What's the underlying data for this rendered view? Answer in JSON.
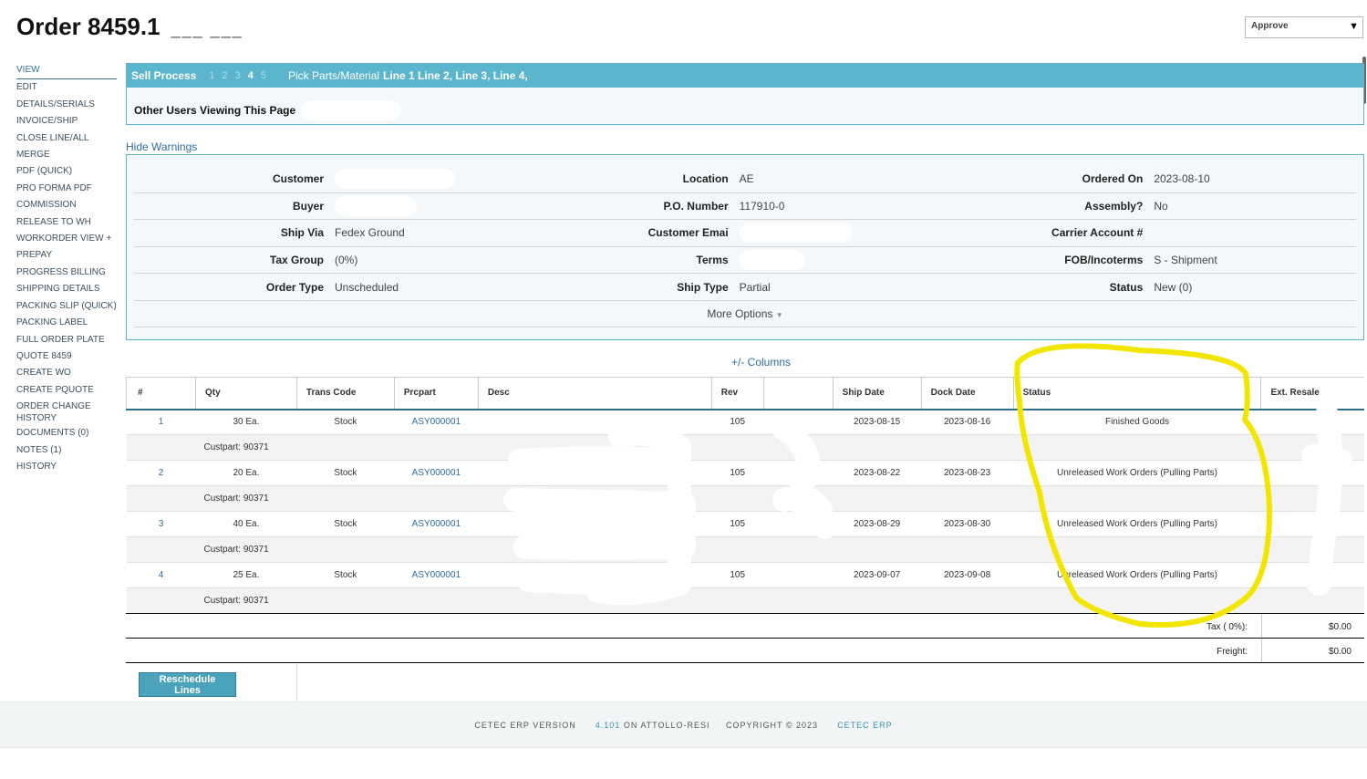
{
  "header": {
    "title": "Order 8459.1",
    "title_suffix": "___ ___",
    "approve_label": "Approve"
  },
  "nav": [
    "VIEW",
    "EDIT",
    "DETAILS/SERIALS",
    "INVOICE/SHIP",
    "CLOSE LINE/ALL",
    "MERGE",
    "PDF (QUICK)",
    "PRO FORMA PDF",
    "COMMISSION",
    "RELEASE TO WH",
    "WORKORDER VIEW +",
    "PREPAY",
    "PROGRESS BILLING",
    "SHIPPING DETAILS",
    "PACKING SLIP (QUICK)",
    "PACKING LABEL",
    "FULL ORDER PLATE",
    "QUOTE 8459",
    "CREATE WO",
    "CREATE PQUOTE",
    "ORDER CHANGE HISTORY",
    "DOCUMENTS (0)",
    "NOTES (1)",
    "HISTORY"
  ],
  "process": {
    "title": "Sell Process",
    "steps": [
      "1",
      "2",
      "3",
      "4",
      "5"
    ],
    "current_step": "4",
    "pick_label": "Pick Parts/Material",
    "lines": "Line 1 Line 2, Line 3, Line 4,",
    "viewers_label": "Other Users Viewing This Page"
  },
  "warnings_toggle": "Hide Warnings",
  "details": {
    "rows": [
      [
        [
          "Customer",
          ""
        ],
        [
          "Location",
          "AE"
        ],
        [
          "Ordered On",
          "2023-08-10"
        ]
      ],
      [
        [
          "Buyer",
          ""
        ],
        [
          "P.O. Number",
          "117910-0"
        ],
        [
          "Assembly?",
          "No"
        ]
      ],
      [
        [
          "Ship Via",
          "Fedex Ground"
        ],
        [
          "Customer Emai",
          ""
        ],
        [
          "Carrier Account #",
          ""
        ]
      ],
      [
        [
          "Tax Group",
          "(0%)"
        ],
        [
          "Terms",
          ""
        ],
        [
          "FOB/Incoterms",
          "S - Shipment"
        ]
      ],
      [
        [
          "Order Type",
          "Unscheduled"
        ],
        [
          "Ship Type",
          "Partial"
        ],
        [
          "Status",
          "New (0)"
        ]
      ]
    ],
    "more_options": "More Options"
  },
  "columns_toggle": "+/- Columns",
  "table": {
    "headers": [
      "#",
      "Qty",
      "Trans Code",
      "Prcpart",
      "Desc",
      "Rev",
      "",
      "Ship Date",
      "Dock Date",
      "Status",
      "Ext. Resale"
    ],
    "rows": [
      {
        "num": "1",
        "qty": "30 Ea.",
        "trans": "Stock",
        "part": "ASY000001",
        "desc": "",
        "rev": "105",
        "ship": "2023-08-15",
        "dock": "2023-08-16",
        "status": "Finished Goods",
        "resale": "",
        "custpart": "Custpart: 90371"
      },
      {
        "num": "2",
        "qty": "20 Ea.",
        "trans": "Stock",
        "part": "ASY000001",
        "desc": "",
        "rev": "105",
        "ship": "2023-08-22",
        "dock": "2023-08-23",
        "status": "Unreleased Work Orders (Pulling Parts)",
        "resale": "",
        "custpart": "Custpart: 90371"
      },
      {
        "num": "3",
        "qty": "40 Ea.",
        "trans": "Stock",
        "part": "ASY000001",
        "desc": "",
        "rev": "105",
        "ship": "2023-08-29",
        "dock": "2023-08-30",
        "status": "Unreleased Work Orders (Pulling Parts)",
        "resale": "",
        "custpart": "Custpart: 90371"
      },
      {
        "num": "4",
        "qty": "25 Ea.",
        "trans": "Stock",
        "part": "ASY000001",
        "desc": "",
        "rev": "105",
        "ship": "2023-09-07",
        "dock": "2023-09-08",
        "status": "Unreleased Work Orders (Pulling Parts)",
        "resale": "",
        "custpart": "Custpart: 90371"
      }
    ]
  },
  "totals": {
    "tax_label": "Tax ( 0%):",
    "tax_value": "$0.00",
    "freight_label": "Freight:",
    "freight_value": "$0.00"
  },
  "reschedule_label": "Reschedule Lines",
  "footer": {
    "prefix": "CETEC ERP VERSION",
    "version": "4.101",
    "on_host": "ON ATTOLLO-RESI",
    "copyright": "COPYRIGHT © 2023",
    "brand": "CETEC ERP"
  },
  "colors": {
    "accent": "#5bb5cc",
    "annotation": "#f2e600",
    "link": "#2e6e9e"
  }
}
